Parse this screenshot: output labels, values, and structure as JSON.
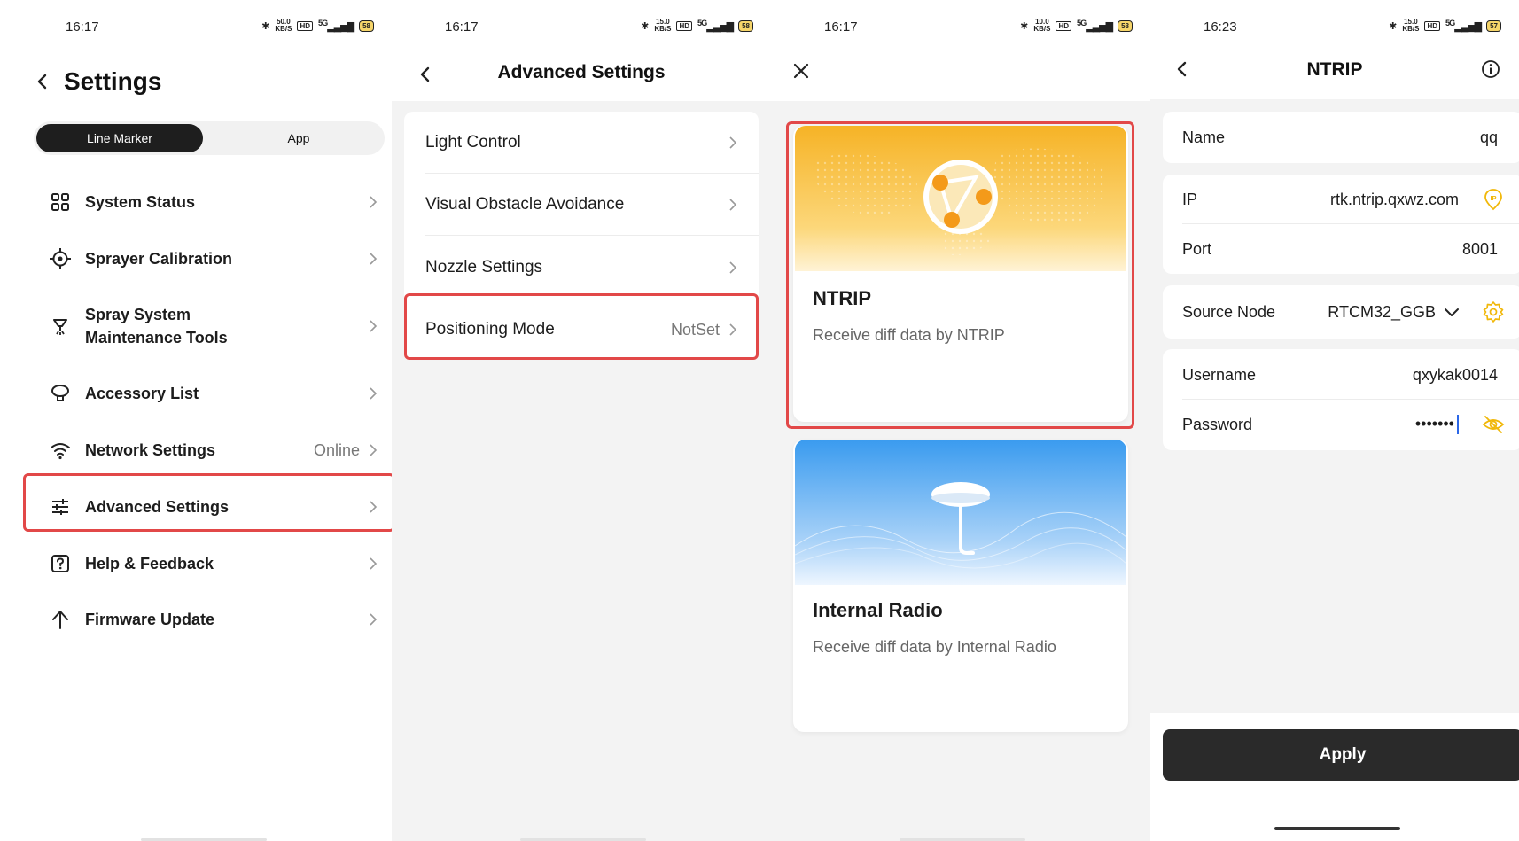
{
  "status_bars": [
    {
      "time": "16:17",
      "net_speed": "50.0",
      "net_unit": "KB/S",
      "hd": "HD",
      "signal": "5G",
      "battery": "58"
    },
    {
      "time": "16:17",
      "net_speed": "15.0",
      "net_unit": "KB/S",
      "hd": "HD",
      "signal": "5G",
      "battery": "58"
    },
    {
      "time": "16:17",
      "net_speed": "10.0",
      "net_unit": "KB/S",
      "hd": "HD",
      "signal": "5G",
      "battery": "58"
    },
    {
      "time": "16:23",
      "net_speed": "15.0",
      "net_unit": "KB/S",
      "hd": "HD",
      "signal": "5G",
      "battery": "57"
    }
  ],
  "settings": {
    "title": "Settings",
    "tabs": [
      "Line Marker",
      "App"
    ],
    "active_tab": "Line Marker",
    "items": [
      {
        "label": "System Status",
        "value": "",
        "icon": "grid-icon"
      },
      {
        "label": "Sprayer Calibration",
        "value": "",
        "icon": "target-icon"
      },
      {
        "label": "Spray System Maintenance Tools",
        "label_line1": "Spray System",
        "label_line2": "Maintenance Tools",
        "value": "",
        "icon": "nozzle-icon"
      },
      {
        "label": "Accessory List",
        "value": "",
        "icon": "accessory-icon"
      },
      {
        "label": "Network Settings",
        "value": "Online",
        "icon": "wifi-icon"
      },
      {
        "label": "Advanced Settings",
        "value": "",
        "icon": "sliders-icon",
        "highlighted": true
      },
      {
        "label": "Help & Feedback",
        "value": "",
        "icon": "help-icon"
      },
      {
        "label": "Firmware Update",
        "value": "",
        "icon": "upload-icon"
      }
    ]
  },
  "advanced": {
    "title": "Advanced Settings",
    "items": [
      {
        "label": "Light Control",
        "value": ""
      },
      {
        "label": "Visual Obstacle Avoidance",
        "value": ""
      },
      {
        "label": "Nozzle Settings",
        "value": ""
      },
      {
        "label": "Positioning Mode",
        "value": "NotSet",
        "highlighted": true
      }
    ]
  },
  "positioning": {
    "modes": [
      {
        "title": "NTRIP",
        "description": "Receive diff data by NTRIP",
        "highlighted": true,
        "color": "#f7b62c"
      },
      {
        "title": "Internal Radio",
        "description": "Receive diff data by Internal Radio",
        "color": "#3b9ef0"
      }
    ]
  },
  "ntrip": {
    "title": "NTRIP",
    "name_label": "Name",
    "name_value": "qq",
    "ip_label": "IP",
    "ip_value": "rtk.ntrip.qxwz.com",
    "ip_badge": "IP",
    "port_label": "Port",
    "port_value": "8001",
    "source_label": "Source Node",
    "source_value": "RTCM32_GGB",
    "username_label": "Username",
    "username_value": "qxykak0014",
    "password_label": "Password",
    "password_value": "•••••••",
    "apply_label": "Apply"
  },
  "colors": {
    "highlight": "#e24848",
    "accent": "#f1b80a",
    "dark_button": "#2a2a2a"
  }
}
